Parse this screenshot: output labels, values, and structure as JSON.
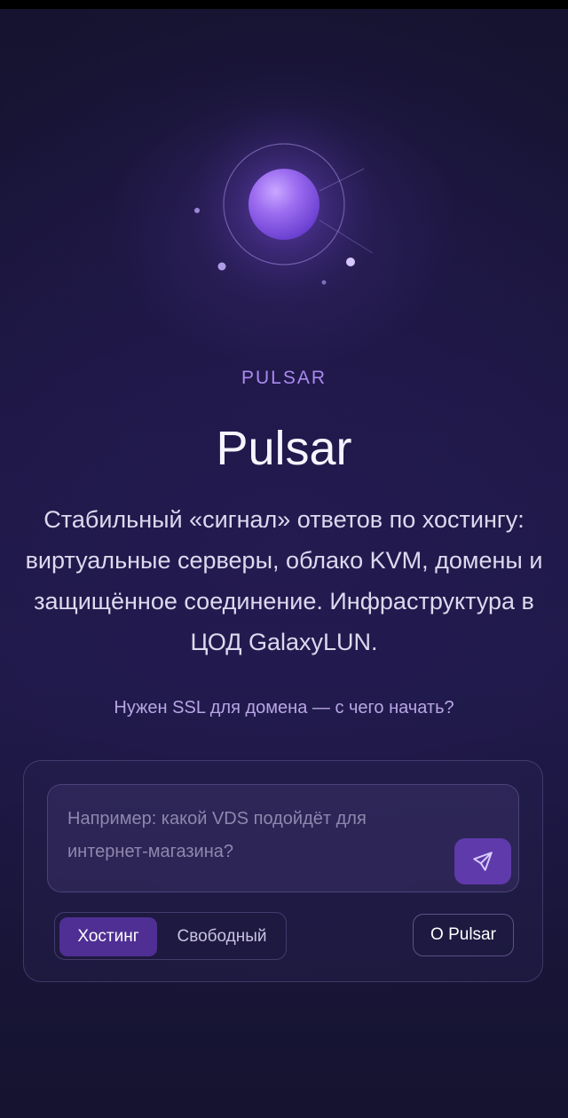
{
  "brand": {
    "eyebrow": "PULSAR",
    "title": "Pulsar",
    "description": "Стабильный «сигнал» ответов по хостингу: виртуальные серверы, облако KVM, домены и защищённое соединение. Инфраструктура в ЦОД GalaxyLUN.",
    "suggestion": "Нужен SSL для домена — с чего начать?"
  },
  "chat": {
    "input_value": "",
    "input_placeholder": "Например: какой VDS подойдёт для интернет-магазина?",
    "send_icon": "send-icon",
    "modes": [
      {
        "label": "Хостинг",
        "active": true
      },
      {
        "label": "Свободный",
        "active": false
      }
    ],
    "about_label": "О Pulsar"
  },
  "hero": {
    "icon": "pulsar-orb-icon"
  },
  "colors": {
    "accent": "#a98af0",
    "orb": "#9e72f2",
    "button": "#5e3aaa",
    "active_tab": "#4f2f94"
  }
}
